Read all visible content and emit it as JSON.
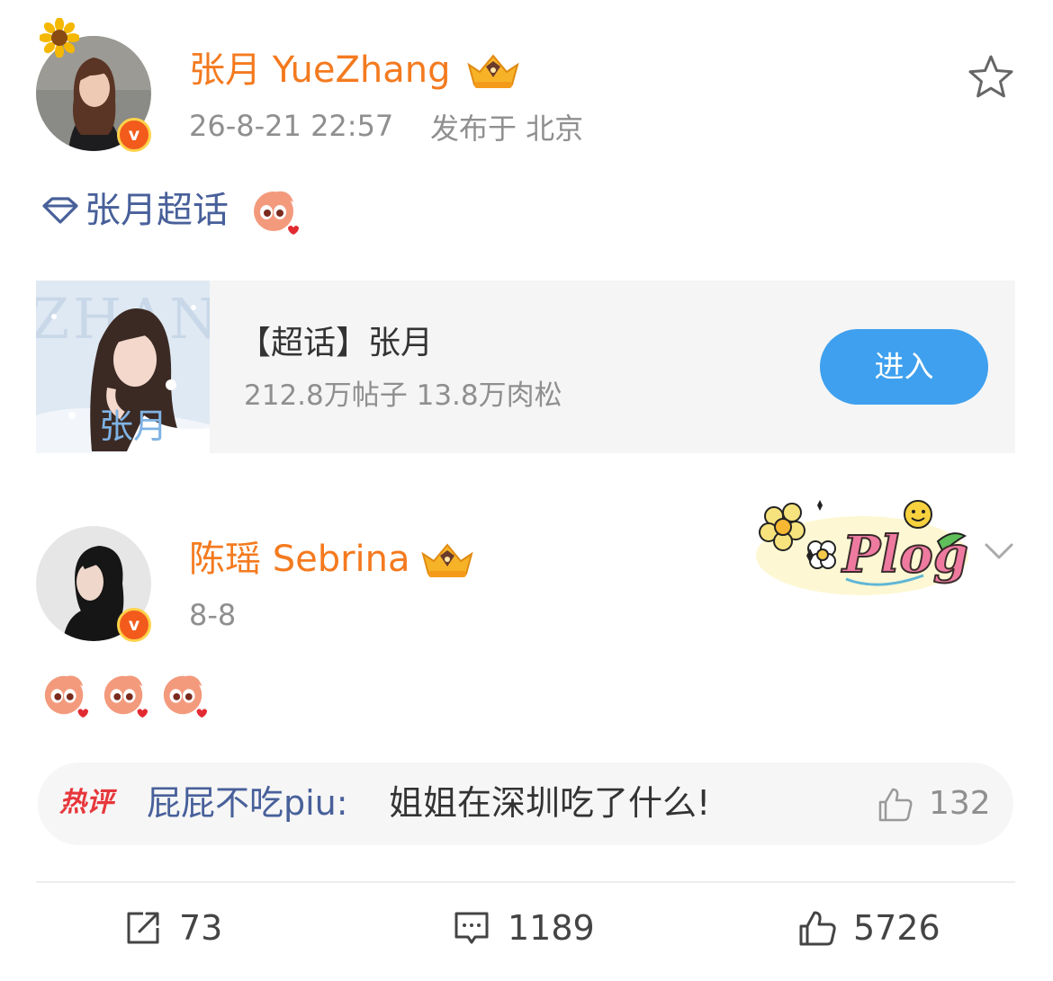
{
  "post": {
    "author": "张月 YueZhang",
    "timestamp": "26-8-21 22:57",
    "location": "发布于 北京",
    "topic_text": "张月超话",
    "card": {
      "title": "【超话】张月",
      "stats": "212.8万帖子 13.8万肉松",
      "enter_label": "进入",
      "image_caption": "张月"
    }
  },
  "repost": {
    "author": "陈瑶 Sebrina",
    "timestamp": "8-8",
    "sticker_text": "Plog"
  },
  "hot_comment": {
    "tag": "热评",
    "user": "屁屁不吃piu:",
    "text": "姐姐在深圳吃了什么!",
    "likes": "132"
  },
  "actions": {
    "reposts": "73",
    "comments": "1189",
    "likes": "5726"
  },
  "colors": {
    "username": "#f47a1f",
    "topic": "#48609a",
    "button": "#3ea0ee",
    "hot_tag": "#e7373c",
    "verified_badge": "#f25b1c"
  },
  "icons": {
    "sunflower": "sunflower-icon",
    "crown": "crown-icon",
    "star": "star-icon",
    "diamond": "diamond-icon",
    "chevron": "chevron-down-icon",
    "repost": "repost-icon",
    "comment": "comment-icon",
    "like": "thumbs-up-icon"
  }
}
